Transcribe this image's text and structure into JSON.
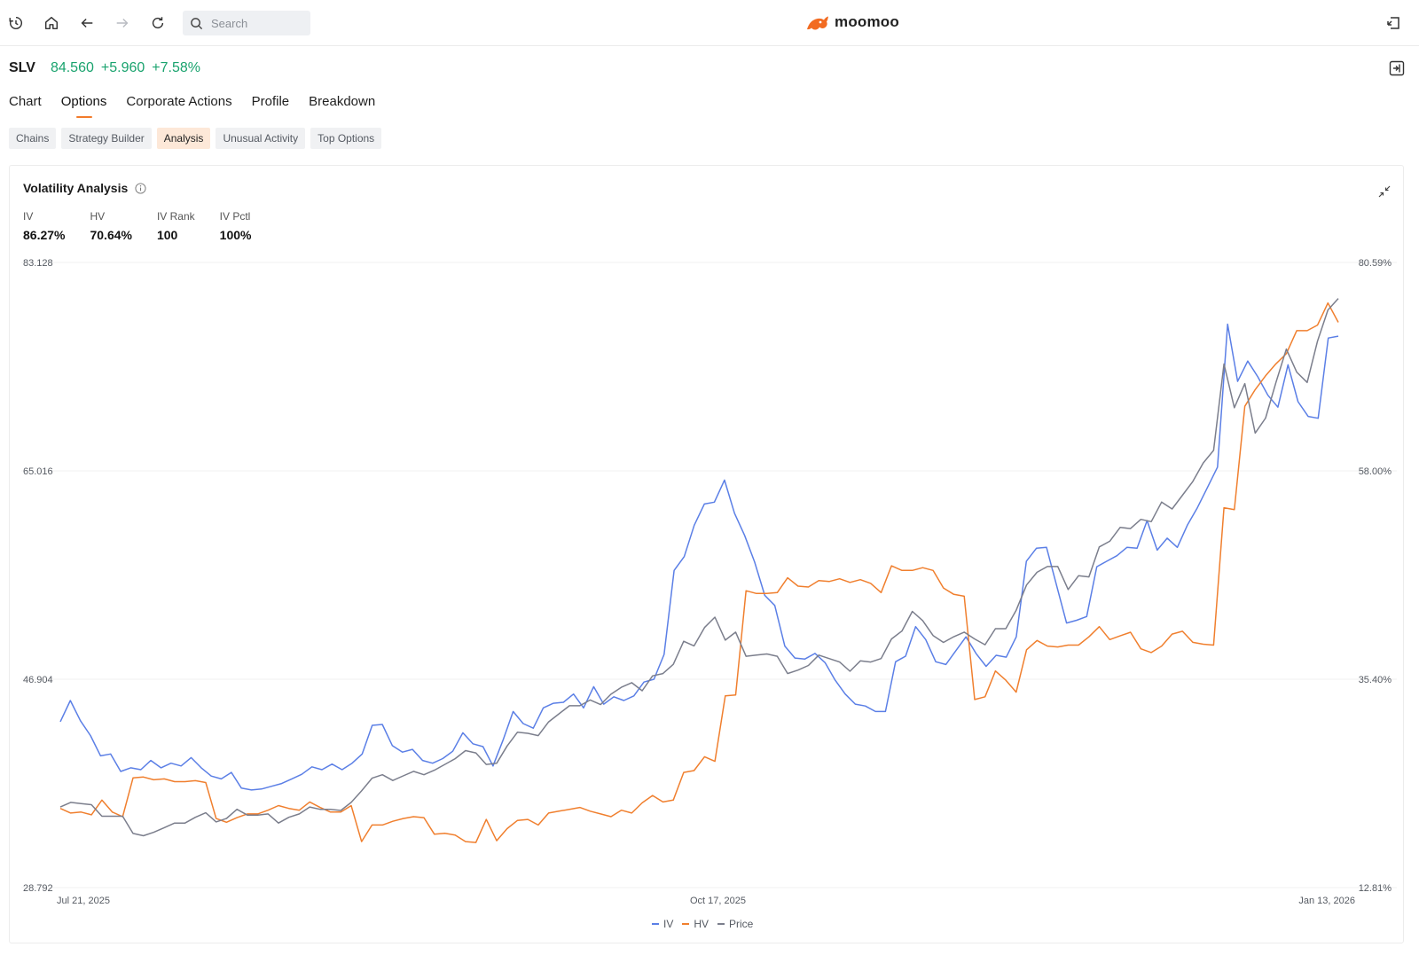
{
  "toolbar": {
    "search_placeholder": "Search",
    "icons": [
      "history-icon",
      "home-icon",
      "back-arrow-icon",
      "forward-arrow-icon",
      "refresh-icon",
      "search-icon",
      "exit-icon"
    ]
  },
  "brand": {
    "name": "moomoo",
    "accent": "#f26b21"
  },
  "quote": {
    "symbol": "SLV",
    "price": "84.560",
    "change": "+5.960",
    "change_pct": "+7.58%",
    "color": "#1aa36e"
  },
  "tabs": [
    "Chart",
    "Options",
    "Corporate Actions",
    "Profile",
    "Breakdown"
  ],
  "active_tab": "Options",
  "subtabs": [
    "Chains",
    "Strategy Builder",
    "Analysis",
    "Unusual Activity",
    "Top Options"
  ],
  "active_subtab": "Analysis",
  "card": {
    "title": "Volatility Analysis",
    "metrics": [
      {
        "label": "IV",
        "value": "86.27%"
      },
      {
        "label": "HV",
        "value": "70.64%"
      },
      {
        "label": "IV Rank",
        "value": "100"
      },
      {
        "label": "IV Pctl",
        "value": "100%"
      }
    ]
  },
  "chart_data": {
    "type": "line",
    "left_axis_ticks": [
      "83.128",
      "65.016",
      "46.904",
      "28.792"
    ],
    "right_axis_ticks": [
      "80.59%",
      "58.00%",
      "35.40%",
      "12.81%"
    ],
    "left_range": [
      28.792,
      83.128
    ],
    "right_range": [
      12.81,
      80.59
    ],
    "x_tick_labels": [
      "Jul 21, 2025",
      "Oct 17, 2025",
      "Jan 13, 2026"
    ],
    "grid": true,
    "legend_position": "bottom-center",
    "series": [
      {
        "name": "IV",
        "color": "#5b7fe6",
        "axis": "right",
        "values": [
          30.8,
          33.1,
          30.9,
          29.3,
          27.1,
          27.3,
          25.4,
          25.8,
          25.6,
          26.6,
          25.8,
          26.3,
          26.0,
          26.9,
          25.8,
          24.9,
          24.6,
          25.3,
          23.6,
          23.4,
          23.5,
          23.8,
          24.1,
          24.6,
          25.1,
          25.9,
          25.6,
          26.2,
          25.6,
          26.3,
          27.3,
          30.4,
          30.5,
          28.2,
          27.5,
          27.8,
          26.6,
          26.3,
          26.8,
          27.6,
          29.6,
          28.4,
          28.1,
          26.0,
          28.8,
          31.9,
          30.6,
          30.1,
          32.3,
          32.8,
          32.9,
          33.8,
          32.3,
          34.6,
          32.7,
          33.5,
          33.1,
          33.6,
          35.1,
          35.4,
          38.1,
          47.2,
          48.7,
          52.1,
          54.4,
          54.6,
          57.0,
          53.4,
          51.0,
          48.1,
          44.5,
          43.4,
          39.0,
          37.7,
          37.6,
          38.2,
          37.2,
          35.3,
          33.8,
          32.7,
          32.5,
          31.9,
          31.9,
          37.3,
          37.9,
          41.1,
          39.7,
          37.3,
          37.0,
          38.5,
          40.0,
          38.2,
          36.8,
          38.0,
          37.8,
          40.0,
          48.2,
          49.6,
          49.7,
          45.6,
          41.5,
          41.8,
          42.2,
          47.6,
          48.2,
          48.8,
          49.7,
          49.6,
          52.6,
          49.4,
          50.7,
          49.7,
          52.1,
          54.0,
          56.2,
          58.4,
          73.9,
          67.7,
          69.9,
          68.2,
          66.2,
          64.9,
          69.5,
          65.5,
          63.9,
          63.7,
          72.4,
          72.6
        ]
      },
      {
        "name": "HV",
        "color": "#f07f2e",
        "axis": "right",
        "values": [
          21.4,
          20.9,
          21.0,
          20.7,
          22.3,
          21.0,
          20.5,
          24.7,
          24.8,
          24.5,
          24.6,
          24.3,
          24.3,
          24.4,
          24.2,
          20.3,
          19.9,
          20.4,
          20.8,
          20.8,
          21.2,
          21.7,
          21.4,
          21.2,
          22.1,
          21.5,
          21.0,
          21.0,
          21.7,
          17.8,
          19.6,
          19.6,
          20.0,
          20.3,
          20.5,
          20.4,
          18.6,
          18.7,
          18.5,
          17.8,
          17.7,
          20.2,
          17.9,
          19.2,
          20.1,
          20.2,
          19.6,
          20.9,
          21.1,
          21.3,
          21.5,
          21.1,
          20.8,
          20.5,
          21.2,
          20.9,
          22.0,
          22.8,
          22.1,
          22.3,
          25.3,
          25.5,
          27.0,
          26.5,
          33.6,
          33.7,
          45.0,
          44.7,
          44.7,
          44.8,
          46.4,
          45.5,
          45.4,
          46.1,
          46.0,
          46.3,
          45.9,
          46.2,
          45.8,
          44.8,
          47.7,
          47.2,
          47.2,
          47.5,
          47.2,
          45.3,
          44.6,
          44.4,
          33.2,
          33.5,
          36.3,
          35.3,
          34.0,
          38.6,
          39.6,
          39.0,
          38.9,
          39.1,
          39.1,
          40.0,
          41.1,
          39.7,
          40.1,
          40.5,
          38.7,
          38.3,
          39.0,
          40.3,
          40.6,
          39.4,
          39.2,
          39.1,
          54.0,
          53.8,
          65.0,
          66.8,
          68.3,
          69.6,
          70.7,
          73.2,
          73.2,
          73.8,
          76.2,
          74.1
        ]
      },
      {
        "name": "Price",
        "color": "#7b7e8c",
        "axis": "left",
        "values": [
          35.8,
          36.2,
          36.1,
          36.0,
          35.0,
          35.0,
          35.0,
          33.5,
          33.3,
          33.6,
          34.0,
          34.4,
          34.4,
          34.9,
          35.3,
          34.5,
          34.8,
          35.6,
          35.1,
          35.1,
          35.2,
          34.4,
          34.9,
          35.2,
          35.8,
          35.6,
          35.6,
          35.5,
          36.2,
          37.2,
          38.3,
          38.6,
          38.1,
          38.5,
          38.9,
          38.6,
          39.0,
          39.5,
          40.0,
          40.7,
          40.5,
          39.5,
          39.6,
          41.1,
          42.3,
          42.2,
          42.0,
          43.2,
          43.9,
          44.6,
          44.6,
          45.1,
          44.7,
          45.6,
          46.2,
          46.6,
          45.9,
          47.2,
          47.4,
          48.2,
          50.2,
          49.8,
          51.4,
          52.3,
          50.3,
          51.0,
          48.9,
          49.0,
          49.1,
          48.9,
          47.4,
          47.7,
          48.1,
          49.0,
          48.7,
          48.4,
          47.6,
          48.5,
          48.4,
          48.7,
          50.4,
          51.1,
          52.8,
          52.0,
          50.7,
          50.1,
          50.6,
          51.0,
          50.4,
          49.9,
          51.3,
          51.3,
          52.9,
          55.1,
          56.2,
          56.7,
          56.7,
          54.7,
          55.9,
          55.8,
          58.4,
          58.9,
          60.1,
          60.0,
          60.8,
          60.6,
          62.3,
          61.7,
          62.9,
          64.1,
          65.7,
          66.8,
          74.3,
          70.5,
          72.6,
          68.3,
          69.6,
          72.7,
          75.6,
          73.6,
          72.7,
          76.3,
          79.0,
          80.0
        ]
      }
    ]
  }
}
